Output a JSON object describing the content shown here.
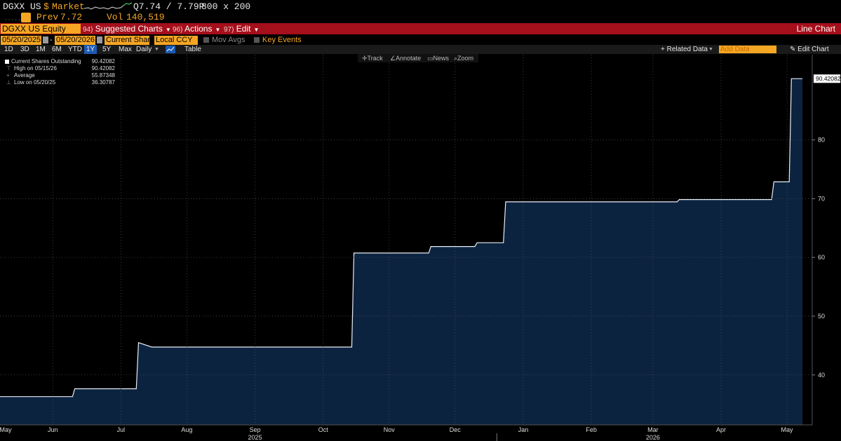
{
  "header": {
    "ticker": "DGXX US",
    "currency": "$",
    "market": "Market",
    "quote": "Q7.74 / 7.79P",
    "size": "800  x  200",
    "prev_label": "Prev",
    "prev_value": "7.72",
    "vol_label": "Vol",
    "vol_value": "140,519"
  },
  "menu": {
    "security": "DGXX US Equity",
    "items": [
      {
        "num": "94)",
        "label": "Suggested Charts"
      },
      {
        "num": "96)",
        "label": "Actions"
      },
      {
        "num": "97)",
        "label": "Edit"
      }
    ],
    "chart_title": "Line Chart"
  },
  "controls": {
    "start_date": "05/20/2025",
    "end_date": "05/20/2026",
    "field": "Current Shares",
    "currency": "Local CCY",
    "mov_avgs": "Mov Avgs",
    "key_events": "Key Events",
    "periods": [
      "1D",
      "3D",
      "1M",
      "6M",
      "YTD",
      "1Y",
      "5Y",
      "Max"
    ],
    "selected_period": "1Y",
    "frequency": "Daily",
    "table": "Table",
    "related_data": "+ Related Data",
    "add_data": "Add Data",
    "edit_chart": "Edit Chart"
  },
  "chart_tools": [
    "Track",
    "Annotate",
    "News",
    "Zoom"
  ],
  "legend": {
    "series": {
      "label": "Current Shares Outstanding",
      "value": "90.42082"
    },
    "high": {
      "label": "High on 05/15/26",
      "value": "90.42082"
    },
    "average": {
      "label": "Average",
      "value": "55.87348"
    },
    "low": {
      "label": "Low on 05/20/25",
      "value": "36.30787"
    }
  },
  "colors": {
    "amber": "#f5a623",
    "menu_red": "#a50f1b",
    "area_fill": "#0c2340",
    "line": "#e8eef5",
    "grid": "#3a3a3a"
  },
  "chart_data": {
    "type": "area",
    "series": [
      {
        "name": "Current Shares Outstanding",
        "points": [
          [
            "2025-05-20",
            36.31
          ],
          [
            "2025-06-22",
            36.31
          ],
          [
            "2025-06-23",
            37.65
          ],
          [
            "2025-07-21",
            37.65
          ],
          [
            "2025-07-22",
            45.5
          ],
          [
            "2025-07-28",
            44.75
          ],
          [
            "2025-10-27",
            44.75
          ],
          [
            "2025-10-28",
            60.75
          ],
          [
            "2025-12-01",
            60.75
          ],
          [
            "2025-12-02",
            61.85
          ],
          [
            "2025-12-22",
            61.85
          ],
          [
            "2025-12-23",
            62.5
          ],
          [
            "2026-01-04",
            62.5
          ],
          [
            "2026-01-05",
            69.45
          ],
          [
            "2026-03-24",
            69.45
          ],
          [
            "2026-03-25",
            69.85
          ],
          [
            "2026-05-06",
            69.85
          ],
          [
            "2026-05-07",
            72.85
          ],
          [
            "2026-05-14",
            72.85
          ],
          [
            "2026-05-15",
            90.42
          ],
          [
            "2026-05-20",
            90.42
          ]
        ]
      }
    ],
    "y_ticks": [
      40,
      50,
      60,
      70,
      80
    ],
    "ylim": [
      31.5,
      94.5
    ],
    "last_value_label": "90.42082",
    "x_month_labels": [
      {
        "label": "May",
        "date": "2025-05-20"
      },
      {
        "label": "Jun",
        "date": "2025-06-13"
      },
      {
        "label": "Jul",
        "date": "2025-07-14"
      },
      {
        "label": "Aug",
        "date": "2025-08-13"
      },
      {
        "label": "Sep",
        "date": "2025-09-13"
      },
      {
        "label": "Oct",
        "date": "2025-10-14"
      },
      {
        "label": "Nov",
        "date": "2025-11-13"
      },
      {
        "label": "Dec",
        "date": "2025-12-13"
      },
      {
        "label": "Jan",
        "date": "2026-01-13"
      },
      {
        "label": "Feb",
        "date": "2026-02-13"
      },
      {
        "label": "Mar",
        "date": "2026-03-13"
      },
      {
        "label": "Apr",
        "date": "2026-04-13"
      },
      {
        "label": "May",
        "date": "2026-05-13"
      }
    ],
    "x_year_labels": [
      {
        "label": "2025",
        "date": "2025-09-13"
      },
      {
        "label": "2026",
        "date": "2026-03-13"
      }
    ],
    "xlim": [
      "2025-05-20",
      "2026-05-20"
    ],
    "grid": true,
    "legend_position": "top-left"
  }
}
